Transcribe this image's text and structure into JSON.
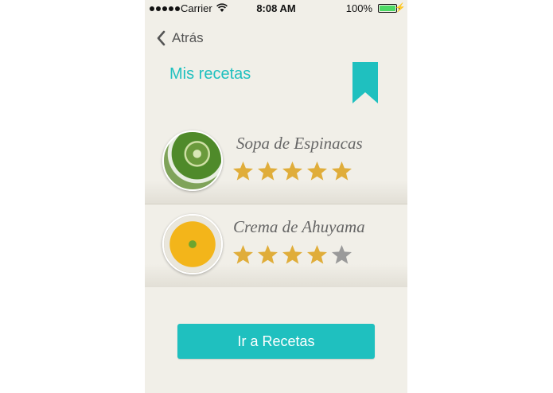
{
  "status_bar": {
    "carrier": "Carrier",
    "time": "8:08 AM",
    "battery": "100%",
    "battery_level": 1.0
  },
  "header": {
    "back_label": "Atrás",
    "title": "Mis recetas",
    "bookmark_icon": "bookmark-icon"
  },
  "recipes": [
    {
      "name": "Sopa de Espinacas",
      "rating": 5,
      "max_rating": 5,
      "image": "spinach-soup-image"
    },
    {
      "name": "Crema de Ahuyama",
      "rating": 4,
      "max_rating": 5,
      "image": "pumpkin-cream-image"
    }
  ],
  "cta": {
    "label": "Ir a Recetas"
  },
  "colors": {
    "accent": "#1fc0bf",
    "star_filled": "#e0ad3a",
    "star_empty": "#9a9a9a",
    "background": "#f1efe8"
  }
}
